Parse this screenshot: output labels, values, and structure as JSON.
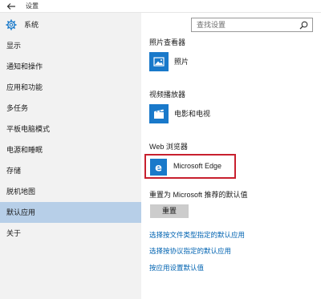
{
  "window": {
    "title": "设置"
  },
  "header": {
    "section": "系统",
    "search_placeholder": "查找设置"
  },
  "sidebar": {
    "items": [
      {
        "label": "显示",
        "active": false
      },
      {
        "label": "通知和操作",
        "active": false
      },
      {
        "label": "应用和功能",
        "active": false
      },
      {
        "label": "多任务",
        "active": false
      },
      {
        "label": "平板电脑模式",
        "active": false
      },
      {
        "label": "电源和睡眠",
        "active": false
      },
      {
        "label": "存储",
        "active": false
      },
      {
        "label": "脱机地图",
        "active": false
      },
      {
        "label": "默认应用",
        "active": true
      },
      {
        "label": "关于",
        "active": false
      }
    ]
  },
  "main": {
    "photo_viewer": {
      "title": "照片查看器",
      "app": "照片"
    },
    "video_player": {
      "title": "视频播放器",
      "app": "电影和电视"
    },
    "web_browser": {
      "title": "Web 浏览器",
      "app": "Microsoft Edge"
    },
    "reset": {
      "title": "重置为 Microsoft 推荐的默认值",
      "button": "重置"
    },
    "links": [
      "选择按文件类型指定的默认应用",
      "选择按协议指定的默认应用",
      "按应用设置默认值"
    ]
  },
  "colors": {
    "accent": "#1979ca",
    "highlight": "#c8202e",
    "selected": "#b7cfe8",
    "link": "#0063b1"
  },
  "icons": {
    "back": "back-arrow-icon",
    "settings": "gear-icon",
    "search": "search-icon",
    "photos": "photos-icon",
    "movies": "movies-tv-icon",
    "edge": "edge-icon"
  }
}
